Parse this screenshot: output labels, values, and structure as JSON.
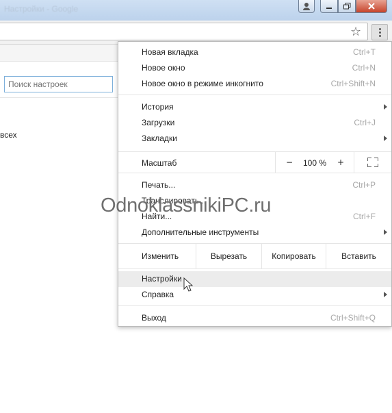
{
  "window": {
    "title": "Настройки - Google"
  },
  "settings_page": {
    "search_placeholder": "Поиск настроек",
    "partial_text": "всех"
  },
  "menu": {
    "items": [
      {
        "label": "Новая вкладка",
        "shortcut": "Ctrl+T"
      },
      {
        "label": "Новое окно",
        "shortcut": "Ctrl+N"
      },
      {
        "label": "Новое окно в режиме инкогнито",
        "shortcut": "Ctrl+Shift+N"
      },
      {
        "label": "История",
        "shortcut": ""
      },
      {
        "label": "Загрузки",
        "shortcut": "Ctrl+J"
      },
      {
        "label": "Закладки",
        "shortcut": ""
      },
      {
        "label": "Печать...",
        "shortcut": "Ctrl+P"
      },
      {
        "label": "Транслировать...",
        "shortcut": ""
      },
      {
        "label": "Найти...",
        "shortcut": "Ctrl+F"
      },
      {
        "label": "Дополнительные инструменты",
        "shortcut": ""
      },
      {
        "label": "Настройки",
        "shortcut": ""
      },
      {
        "label": "Справка",
        "shortcut": ""
      },
      {
        "label": "Выход",
        "shortcut": "Ctrl+Shift+Q"
      }
    ],
    "zoom": {
      "label": "Масштаб",
      "minus": "−",
      "value": "100 %",
      "plus": "+"
    },
    "edit": {
      "label": "Изменить",
      "cut": "Вырезать",
      "copy": "Копировать",
      "paste": "Вставить"
    }
  },
  "watermark": "OdnoklassnikiPC.ru",
  "icons": {
    "star": "star-icon",
    "menu": "three-dots-icon",
    "fullscreen": "fullscreen-icon",
    "submenu": "chevron-right-icon",
    "cursor": "mouse-pointer-icon"
  },
  "colors": {
    "shortcut": "#a8a8a8",
    "hover": "#ececec",
    "search_border": "#7eb0db"
  }
}
